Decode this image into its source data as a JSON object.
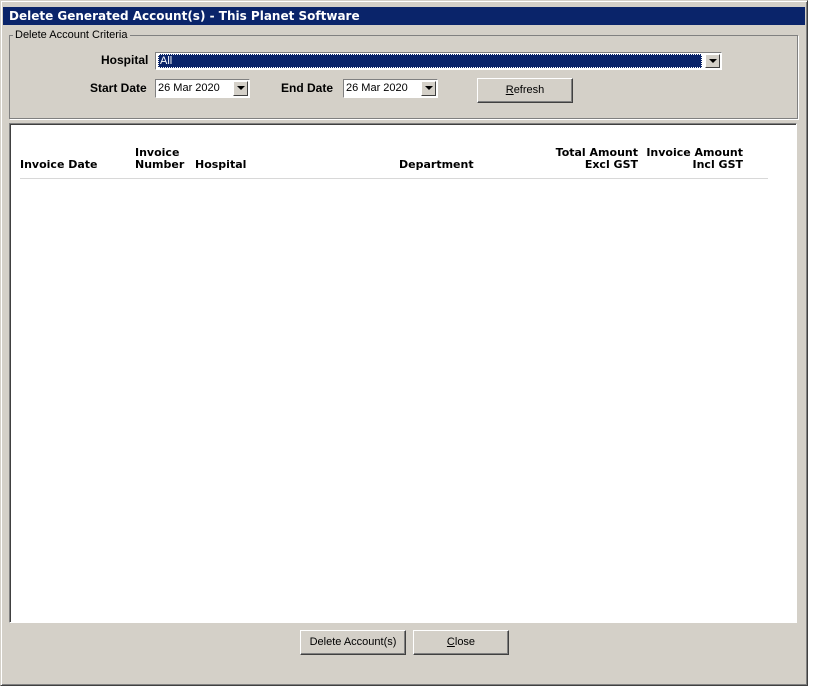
{
  "window": {
    "title": "Delete Generated Account(s)  -  This Planet Software"
  },
  "criteria": {
    "group_label": "Delete Account Criteria",
    "hospital_label": "Hospital",
    "hospital_value": "All",
    "start_date_label": "Start Date",
    "start_date_value": "26 Mar 2020",
    "end_date_label": "End Date",
    "end_date_value": "26 Mar 2020",
    "refresh_pre": "",
    "refresh_accel": "R",
    "refresh_post": "efresh"
  },
  "table": {
    "columns": {
      "invoice_date": "Invoice Date",
      "invoice_number_1": "Invoice",
      "invoice_number_2": "Number",
      "hospital": "Hospital",
      "department": "Department",
      "total_amount_1": "Total Amount",
      "total_amount_2": "Excl GST",
      "invoice_amount_1": "Invoice Amount",
      "invoice_amount_2": "Incl GST"
    },
    "rows": []
  },
  "footer": {
    "delete_label": "Delete Account(s)",
    "close_accel": "C",
    "close_post": "lose"
  }
}
